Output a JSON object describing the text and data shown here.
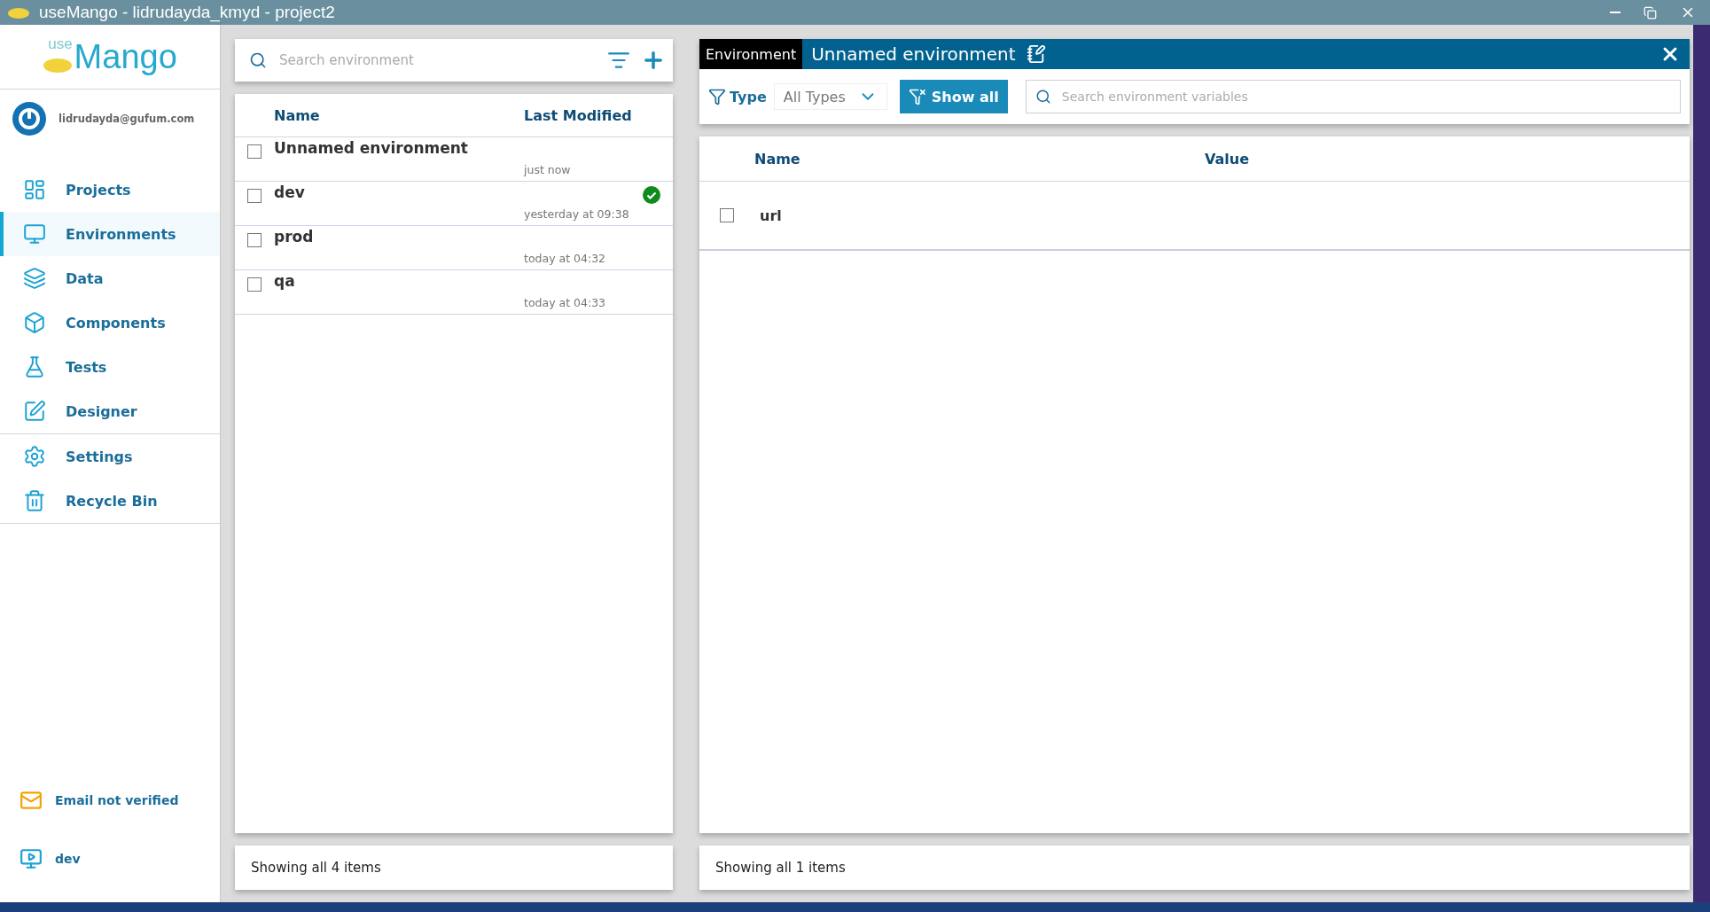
{
  "window": {
    "title": "useMango - lidrudayda_kmyd - project2"
  },
  "sidebar": {
    "logo_small": "use",
    "logo_large": "Mango",
    "user_email": "lidrudayda@gufum.com",
    "sections": [
      [
        {
          "label": "Projects",
          "selected": false
        },
        {
          "label": "Environments",
          "selected": true
        },
        {
          "label": "Data",
          "selected": false
        },
        {
          "label": "Components",
          "selected": false
        },
        {
          "label": "Tests",
          "selected": false
        },
        {
          "label": "Designer",
          "selected": false
        }
      ],
      [
        {
          "label": "Settings",
          "selected": false
        },
        {
          "label": "Recycle Bin",
          "selected": false
        }
      ]
    ],
    "email_status": "Email not verified",
    "current_environment": "dev"
  },
  "environment_list": {
    "search_placeholder": "Search environment",
    "columns": [
      "Name",
      "Last Modified"
    ],
    "rows": [
      {
        "name": "Unnamed environment",
        "modified": "just now",
        "checked": false,
        "active": false
      },
      {
        "name": "dev",
        "modified": "yesterday at 09:38",
        "checked": false,
        "active": true
      },
      {
        "name": "prod",
        "modified": "today at 04:32",
        "checked": false,
        "active": false
      },
      {
        "name": "qa",
        "modified": "today at 04:33",
        "checked": false,
        "active": false
      }
    ],
    "footer": "Showing all 4 items"
  },
  "environment_detail": {
    "tag": "Environment",
    "title": "Unnamed environment",
    "filter_label": "Type",
    "type_value": "All Types",
    "show_all_button": "Show all",
    "search_placeholder": "Search environment variables",
    "columns": [
      "Name",
      "Value"
    ],
    "rows": [
      {
        "name": "url",
        "checked": false
      }
    ],
    "footer": "Showing all 1 items"
  }
}
